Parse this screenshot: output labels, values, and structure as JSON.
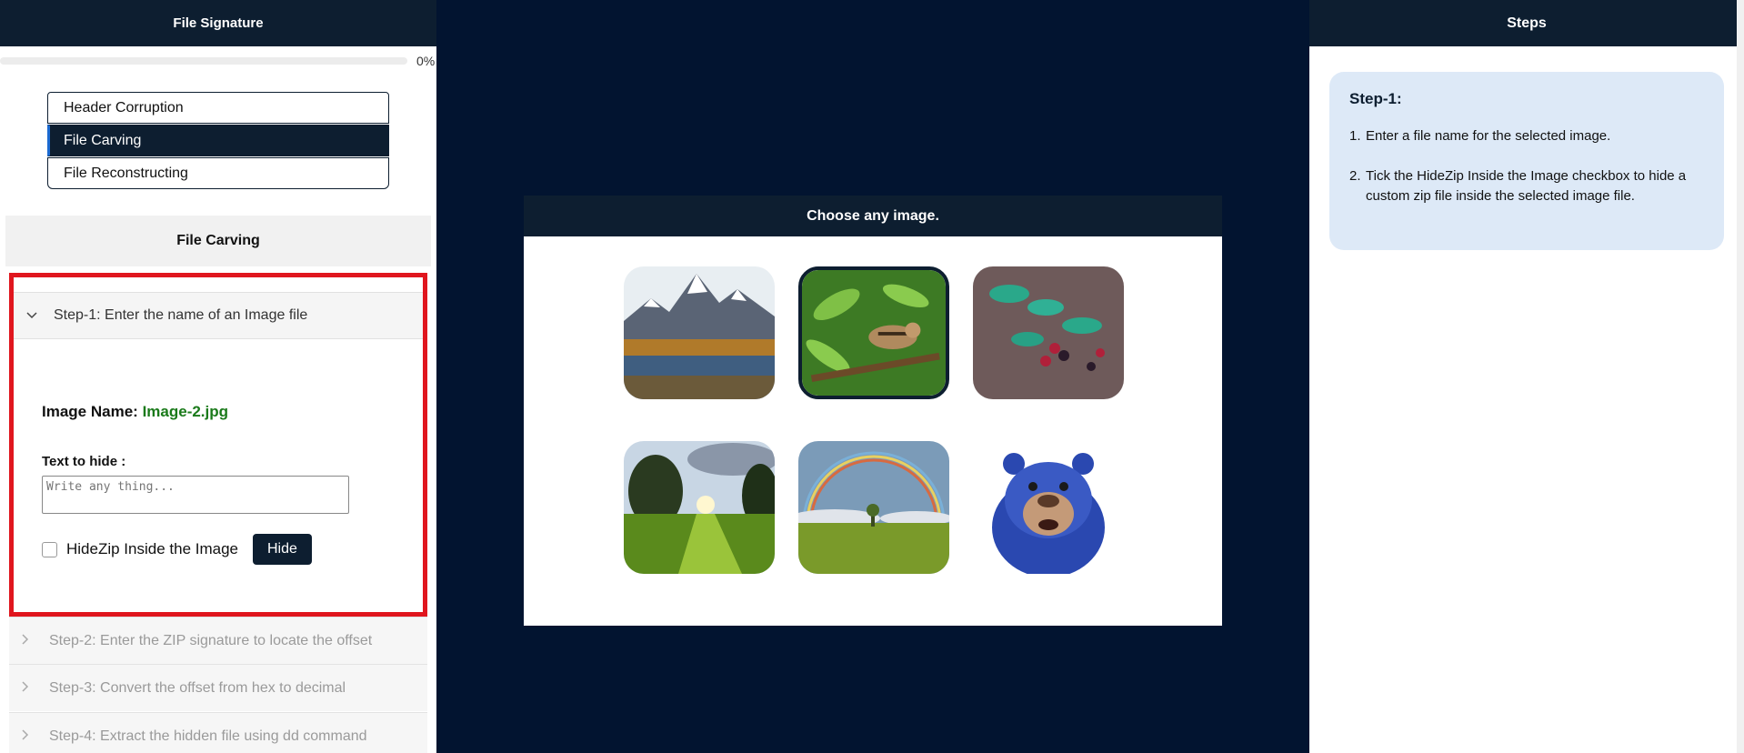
{
  "left_panel": {
    "title": "File Signature",
    "progress_text": "0%",
    "progress_value": 0,
    "modes": [
      "Header Corruption",
      "File Carving",
      "File Reconstructing"
    ],
    "selected_mode": "File Carving",
    "section_title": "File Carving",
    "step1": {
      "header": "Step-1: Enter the name of an Image file",
      "image_name_label": "Image Name:",
      "image_name_value": "Image-2.jpg",
      "text_to_hide_label": "Text to hide :",
      "text_placeholder": "Write any thing...",
      "hidezip_label": "HideZip Inside the Image",
      "hide_button": "Hide"
    },
    "steps": [
      "Step-2: Enter the ZIP signature to locate the offset",
      "Step-3: Convert the offset from hex to decimal",
      "Step-4: Extract the hidden file using dd command"
    ]
  },
  "center": {
    "title": "Choose any image.",
    "images": [
      "mountain-lake-image",
      "chipmunk-image",
      "berries-image",
      "sunset-meadow-image",
      "rainbow-field-image",
      "blue-bear-image"
    ],
    "selected_image_index": 1
  },
  "right_panel": {
    "title": "Steps",
    "card_title": "Step-1:",
    "items": [
      {
        "num": "1.",
        "text": "Enter a file name for the selected image."
      },
      {
        "num": "2.",
        "text": "Tick the HideZip Inside the Image checkbox to hide a custom zip file inside the selected image file."
      }
    ]
  },
  "colors": {
    "navy": "#0d1e30",
    "background": "#021430",
    "highlight_red": "#e0161e",
    "image_name_green": "#1a7a1a",
    "steps_card": "#dde9f7"
  }
}
